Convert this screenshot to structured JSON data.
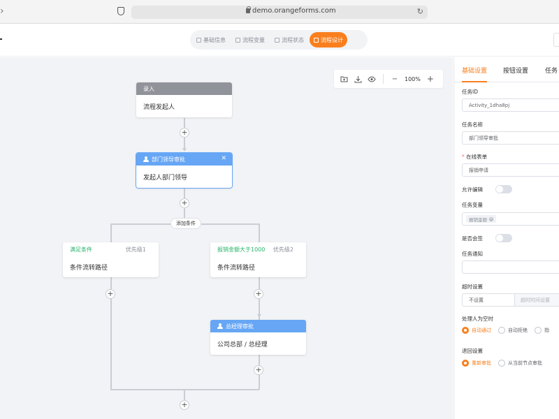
{
  "browser": {
    "url": "demo.orangeforms.com"
  },
  "steps": [
    {
      "label": "基础信息",
      "active": false
    },
    {
      "label": "流程变量",
      "active": false
    },
    {
      "label": "流程状态",
      "active": false
    },
    {
      "label": "流程设计",
      "active": true
    }
  ],
  "toolbar": {
    "zoom": "100%"
  },
  "nodes": {
    "start": {
      "header": "录入",
      "body": "流程发起人"
    },
    "dept": {
      "header": "部门领导审批",
      "body": "发起人部门领导"
    },
    "add_condition": "添加条件",
    "cond1": {
      "name": "满足条件",
      "priority": "优先级1",
      "body": "条件流转路径"
    },
    "cond2": {
      "name": "报销金额大于1000",
      "priority": "优先级2",
      "body": "条件流转路径"
    },
    "gm": {
      "header": "总经理审批",
      "body": "公司总部 / 总经理"
    }
  },
  "panel": {
    "tabs": [
      "基础设置",
      "按钮设置",
      "任务"
    ],
    "task_id_label": "任务ID",
    "task_id_value": "Activity_1dha8pj",
    "task_name_label": "任务名称",
    "task_name_value": "部门领导审批",
    "form_label": "在线表单",
    "form_value": "报销申请",
    "allow_edit_label": "允许编辑",
    "task_var_label": "任务变量",
    "task_var_tag": "报销金额",
    "cosign_label": "是否会签",
    "notify_label": "任务通知",
    "timeout_label": "超时设置",
    "timeout_value": "不设置",
    "timeout_placeholder": "超时时间设置",
    "empty_handler_label": "处理人为空时",
    "empty_handler_options": [
      "自动通过",
      "自动拒绝",
      "指"
    ],
    "reject_label": "退回设置",
    "reject_options": [
      "重新审批",
      "从当前节点审批"
    ]
  },
  "colors": {
    "accent": "#f97f1e",
    "node_blue": "#66a6f5",
    "node_gray": "#909399",
    "condition_green": "#27b36a"
  }
}
